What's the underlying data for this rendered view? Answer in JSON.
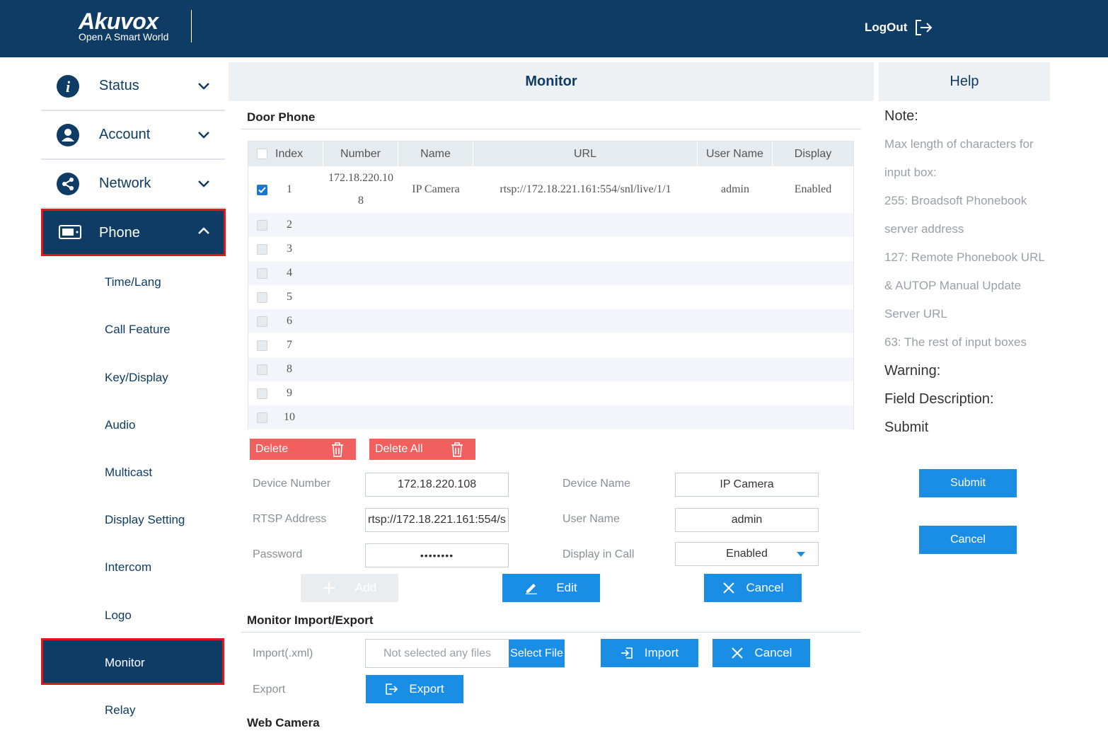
{
  "header": {
    "brand": "Akuvox",
    "tagline": "Open A Smart World",
    "logout_label": "LogOut"
  },
  "sidebar": {
    "top_items": [
      {
        "label": "Status",
        "icon": "info-icon"
      },
      {
        "label": "Account",
        "icon": "user-icon"
      },
      {
        "label": "Network",
        "icon": "network-icon"
      }
    ],
    "phone_label": "Phone",
    "sub_items": [
      "Time/Lang",
      "Call Feature",
      "Key/Display",
      "Audio",
      "Multicast",
      "Display Setting",
      "Intercom",
      "Logo",
      "Monitor",
      "Relay"
    ]
  },
  "tabs": {
    "monitor": "Monitor",
    "help": "Help"
  },
  "door_phone": {
    "title": "Door Phone",
    "columns": [
      "Index",
      "Number",
      "Name",
      "URL",
      "User Name",
      "Display"
    ],
    "rows": [
      {
        "index": "1",
        "number_line1": "172.18.220.10",
        "number_line2": "8",
        "name": "IP Camera",
        "url": "rtsp://172.18.221.161:554/snl/live/1/1",
        "user": "admin",
        "display": "Enabled",
        "checked": true
      },
      {
        "index": "2"
      },
      {
        "index": "3"
      },
      {
        "index": "4"
      },
      {
        "index": "5"
      },
      {
        "index": "6"
      },
      {
        "index": "7"
      },
      {
        "index": "8"
      },
      {
        "index": "9"
      },
      {
        "index": "10"
      }
    ],
    "delete_label": "Delete",
    "delete_all_label": "Delete All"
  },
  "form": {
    "device_number_label": "Device Number",
    "device_number_value": "172.18.220.108",
    "device_name_label": "Device Name",
    "device_name_value": "IP Camera",
    "rtsp_label": "RTSP Address",
    "rtsp_value": "rtsp://172.18.221.161:554/s",
    "user_name_label": "User Name",
    "user_name_value": "admin",
    "password_label": "Password",
    "password_value": "••••••••",
    "display_in_call_label": "Display in Call",
    "display_in_call_value": "Enabled",
    "add_label": "Add",
    "edit_label": "Edit",
    "cancel_label": "Cancel"
  },
  "import_export": {
    "title": "Monitor Import/Export",
    "import_label": "Import(.xml)",
    "file_placeholder": "Not selected any files",
    "select_file_label": "Select File",
    "import_button": "Import",
    "cancel_button": "Cancel",
    "export_label": "Export",
    "export_button": "Export"
  },
  "web_camera": {
    "title": "Web Camera"
  },
  "help": {
    "note_title": "Note:",
    "lines": [
      "Max length of characters for",
      "input box:",
      "255: Broadsoft Phonebook",
      "server address",
      "127: Remote Phonebook URL",
      "& AUTOP Manual Update",
      "Server URL",
      "63: The rest of input boxes"
    ],
    "warning_title": "Warning:",
    "field_desc_title": "Field Description:",
    "submit_title": "Submit",
    "submit_button": "Submit",
    "cancel_button": "Cancel"
  },
  "colors": {
    "primary": "#0f3c64",
    "accent": "#1a8ee5",
    "danger": "#f25f5f",
    "highlight": "#e0161d"
  }
}
